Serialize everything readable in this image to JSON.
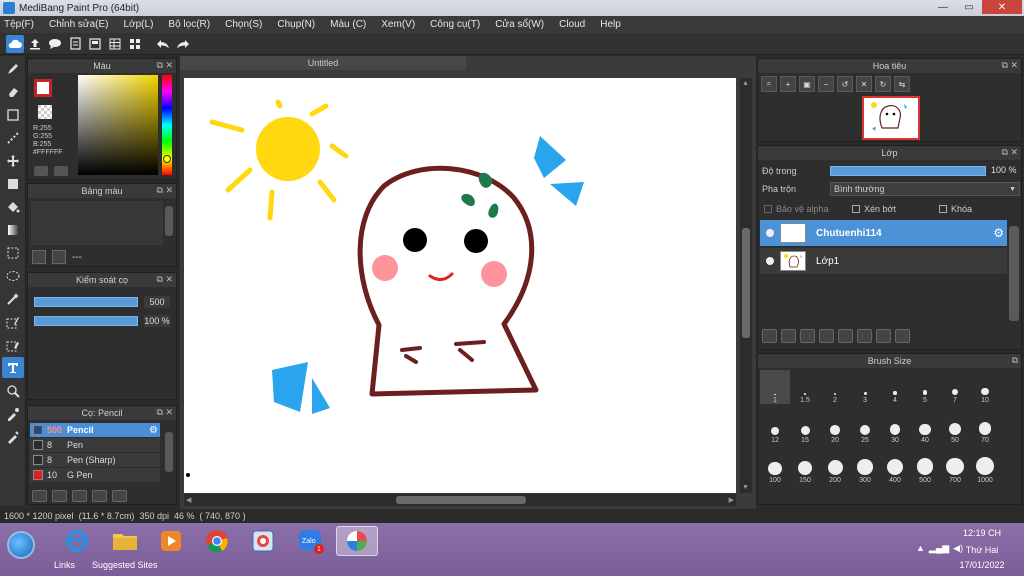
{
  "window": {
    "title": "MediBang Paint Pro (64bit)",
    "minimize": "—",
    "maximize": "▭",
    "close": "✕"
  },
  "menu": [
    "Tệp(F)",
    "Chỉnh sửa(E)",
    "Lớp(L)",
    "Bộ lọc(R)",
    "Chọn(S)",
    "Chụp(N)",
    "Màu (C)",
    "Xem(V)",
    "Công cụ(T)",
    "Cửa sổ(W)",
    "Cloud",
    "Help"
  ],
  "colors": {
    "accent": "#4d92d6",
    "foreground": "#c0262a",
    "background": "#ffffff"
  },
  "color_panel": {
    "title": "Màu",
    "r": "R:255",
    "g": "G:255",
    "b": "B:255",
    "hex": "#FFFFFF"
  },
  "palette_panel": {
    "title": "Bảng màu",
    "dash": "---"
  },
  "brush_control": {
    "title": "Kiểm soát cọ",
    "size": "500",
    "opacity": "100 %",
    "size_fraction": 0.92,
    "opacity_fraction": 1.0
  },
  "brush_list": {
    "title": "Cọ: Pencil",
    "items": [
      {
        "size": "500",
        "name": "Pencil",
        "color": "#2a4a7a",
        "selected": true
      },
      {
        "size": "8",
        "name": "Pen",
        "color": "#2c2c2c",
        "selected": false
      },
      {
        "size": "8",
        "name": "Pen (Sharp)",
        "color": "#2c2c2c",
        "selected": false
      },
      {
        "size": "10",
        "name": "G Pen",
        "color": "#e02020",
        "selected": false
      }
    ]
  },
  "document": {
    "tab": "Untitled"
  },
  "navigator": {
    "title": "Hoa tiêu"
  },
  "layer_panel": {
    "title": "Lớp",
    "opacity_label": "Độ trong",
    "opacity_value": "100 %",
    "opacity_fraction": 1.0,
    "blend_label": "Pha trộn",
    "blend_value": "Bình thường",
    "protect_alpha": "Bảo vệ alpha",
    "clipping": "Xén bớt",
    "lock": "Khóa",
    "layers": [
      {
        "name": "Chutuenhi114",
        "selected": true
      },
      {
        "name": "Lớp1",
        "selected": false
      }
    ]
  },
  "brush_size": {
    "title": "Brush Size",
    "sizes": [
      "1",
      "1.5",
      "2",
      "3",
      "4",
      "5",
      "7",
      "10",
      "12",
      "15",
      "20",
      "25",
      "30",
      "40",
      "50",
      "70",
      "100",
      "150",
      "200",
      "300",
      "400",
      "500",
      "700",
      "1000"
    ]
  },
  "status": {
    "dimensions": "1600 * 1200 pixel",
    "physical": "(11.6 * 8.7cm)",
    "dpi": "350 dpi",
    "zoom": "46 %",
    "coords": "( 740, 870 )"
  },
  "taskbar": {
    "links": "Links",
    "suggested": "Suggested Sites",
    "time": "12:19 CH",
    "day": "Thứ Hai",
    "date": "17/01/2022",
    "zalo_badge": "1"
  }
}
